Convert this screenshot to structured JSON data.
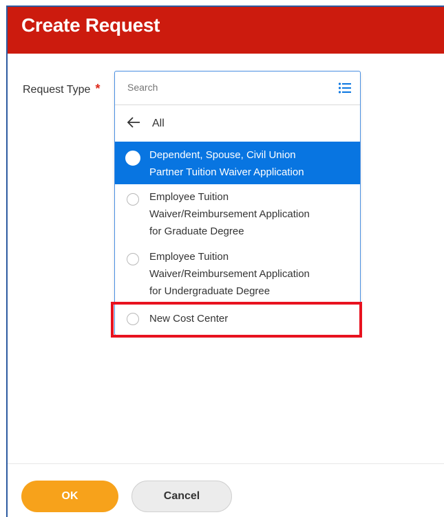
{
  "header": {
    "title": "Create Request"
  },
  "form": {
    "request_type_label": "Request Type",
    "required_marker": "*"
  },
  "dropdown": {
    "search_placeholder": "Search",
    "back_label": "All",
    "options": [
      {
        "line1": "Dependent, Spouse, Civil Union",
        "line2": "Partner Tuition Waiver Application",
        "line3": "",
        "selected": true
      },
      {
        "line1": "Employee Tuition",
        "line2": "Waiver/Reimbursement Application",
        "line3": "for Graduate Degree",
        "selected": false
      },
      {
        "line1": "Employee Tuition",
        "line2": "Waiver/Reimbursement Application",
        "line3": "for Undergraduate Degree",
        "selected": false
      },
      {
        "line1": "New Cost Center",
        "line2": "",
        "line3": "",
        "selected": false
      }
    ]
  },
  "footer": {
    "ok_label": "OK",
    "cancel_label": "Cancel"
  },
  "colors": {
    "header_bg": "#cc1b0e",
    "selected_bg": "#0875e1",
    "ok_button": "#f7a21b",
    "highlight_box": "#e8121f"
  },
  "icons": {
    "list": "list-view-icon",
    "back": "arrow-left-icon"
  }
}
